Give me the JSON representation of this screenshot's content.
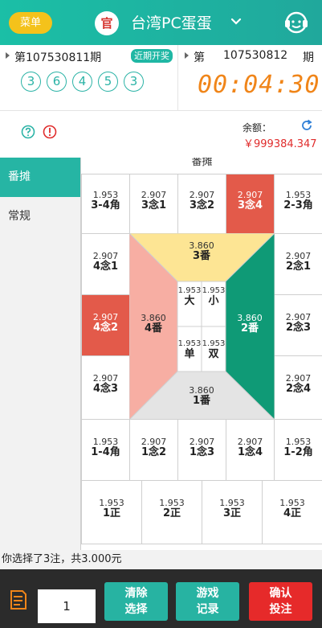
{
  "header": {
    "menu_label": "菜单",
    "logo_text": "官",
    "title": "台湾PC蛋蛋",
    "brand_color": "#1fb5a3"
  },
  "draw": {
    "prev_period": "第107530811期",
    "recent_badge": "近期开奖",
    "balls": [
      "3",
      "6",
      "4",
      "5",
      "3"
    ],
    "next_label_prefix": "第",
    "next_period": "107530812",
    "next_label_suffix": "期",
    "countdown": "00:04:30"
  },
  "info": {
    "balance_label": "余额：",
    "balance_value": "￥999384.347"
  },
  "sidebar": {
    "items": [
      {
        "label": "番摊"
      },
      {
        "label": "常规"
      }
    ]
  },
  "bet": {
    "section_title": "番摊",
    "row1": [
      {
        "odds": "1.953",
        "name": "3-4角"
      },
      {
        "odds": "2.907",
        "name": "3念1"
      },
      {
        "odds": "2.907",
        "name": "3念2"
      },
      {
        "odds": "2.907",
        "name": "3念4"
      },
      {
        "odds": "1.953",
        "name": "2-3角"
      }
    ],
    "left_col": [
      {
        "odds": "2.907",
        "name": "4念1"
      },
      {
        "odds": "2.907",
        "name": "4念2"
      },
      {
        "odds": "2.907",
        "name": "4念3"
      }
    ],
    "right_col": [
      {
        "odds": "2.907",
        "name": "2念1"
      },
      {
        "odds": "2.907",
        "name": "2念3"
      },
      {
        "odds": "2.907",
        "name": "2念4"
      }
    ],
    "fan3": {
      "odds": "3.860",
      "name": "3番"
    },
    "fan4": {
      "odds": "3.860",
      "name": "4番"
    },
    "fan2": {
      "odds": "3.860",
      "name": "2番"
    },
    "fan1": {
      "odds": "3.860",
      "name": "1番"
    },
    "small_big": {
      "odds": "1.953",
      "name": "大"
    },
    "small_small": {
      "odds": "1.953",
      "name": "小"
    },
    "small_odd": {
      "odds": "1.953",
      "name": "单"
    },
    "small_even": {
      "odds": "1.953",
      "name": "双"
    },
    "row_bottom": [
      {
        "odds": "1.953",
        "name": "1-4角"
      },
      {
        "odds": "2.907",
        "name": "1念2"
      },
      {
        "odds": "2.907",
        "name": "1念3"
      },
      {
        "odds": "2.907",
        "name": "1念4"
      },
      {
        "odds": "1.953",
        "name": "1-2角"
      }
    ],
    "row_zheng": [
      {
        "odds": "1.953",
        "name": "1正"
      },
      {
        "odds": "1.953",
        "name": "2正"
      },
      {
        "odds": "1.953",
        "name": "3正"
      },
      {
        "odds": "1.953",
        "name": "4正"
      }
    ],
    "colors": {
      "fan3": "#fde594",
      "fan4": "#f7aea3",
      "fan2": "#0f9a76",
      "fan1": "#e4e4e4",
      "selected": "#e35a4a"
    }
  },
  "summary": {
    "text": "你选择了3注，共3.000元"
  },
  "bottom": {
    "quantity": "1",
    "clear_label": "清除\n选择",
    "record_label": "游戏\n记录",
    "confirm_label": "确认\n投注"
  }
}
